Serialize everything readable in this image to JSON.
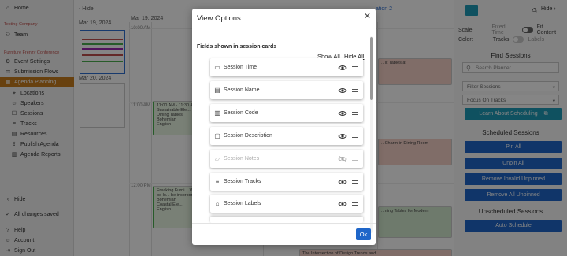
{
  "sidebar": {
    "home": "Home",
    "org": "Testing Company",
    "team": "Team",
    "conference": "Furniture Frenzy Conference",
    "items": [
      {
        "label": "Event Settings",
        "icon": "settings-icon"
      },
      {
        "label": "Submission Flows",
        "icon": "flow-icon"
      },
      {
        "label": "Agenda Planning",
        "icon": "calendar-icon"
      },
      {
        "label": "Locations",
        "icon": "location-icon"
      },
      {
        "label": "Speakers",
        "icon": "person-icon"
      },
      {
        "label": "Sessions",
        "icon": "session-icon"
      },
      {
        "label": "Tracks",
        "icon": "tracks-icon"
      },
      {
        "label": "Resources",
        "icon": "resources-icon"
      },
      {
        "label": "Publish Agenda",
        "icon": "publish-icon"
      },
      {
        "label": "Agenda Reports",
        "icon": "report-icon"
      }
    ],
    "hide": "Hide",
    "saved": "All changes saved",
    "help": "Help",
    "account": "Account",
    "signout": "Sign Out"
  },
  "calendar": {
    "hide": "Hide",
    "date1": "Mar 19, 2024",
    "date2": "Mar 20, 2024",
    "col_date": "Mar 19, 2024",
    "times": [
      "10:00 AM",
      "11:00 AM",
      "12:00 PM"
    ],
    "partial_header": "ation 2",
    "card_a_time": "11:00 AM - 11:30 AM",
    "card_a_title": "Sustainable Ele... Dining Tables",
    "card_a_person": "Bohemian",
    "card_a_lang": "English",
    "card_b_title": "Freaking Furni... We will be lo... be incorporate...",
    "card_b_person1": "Bohemian",
    "card_b_person2": "Coastal Ele...",
    "card_b_lang": "English",
    "card_c_title": "...ic Tables at",
    "card_d_title": "...Charm in Dining Room",
    "card_e_title": "...ning Tables for Modern",
    "card_f_title": "The Intersection of Design Trends and..."
  },
  "right_panel": {
    "hide": "Hide",
    "scale_label": "Scale:",
    "scale_opt1": "Fixed Time",
    "scale_opt2": "Fit Content",
    "color_label": "Color:",
    "color_opt1": "Tracks",
    "color_opt2": "Labels",
    "find_title": "Find Sessions",
    "search_placeholder": "Search Planner",
    "filter_sessions": "Filter Sessions",
    "focus_tracks": "Focus On Tracks",
    "learn_btn": "Learn About Scheduling",
    "scheduled_title": "Scheduled Sessions",
    "pin_all": "Pin All",
    "unpin_all": "Unpin All",
    "remove_invalid": "Remove Invalid Unpinned",
    "remove_all": "Remove All Unpinned",
    "unscheduled_title": "Unscheduled Sessions",
    "auto_schedule": "Auto Schedule"
  },
  "modal": {
    "title": "View Options",
    "subtitle": "Fields shown in session cards",
    "show_all": "Show All",
    "hide_all": "Hide All",
    "fields": [
      {
        "label": "Session Time",
        "icon": "clock-icon",
        "visible": true
      },
      {
        "label": "Session Name",
        "icon": "name-icon",
        "visible": true
      },
      {
        "label": "Session Code",
        "icon": "barcode-icon",
        "visible": true
      },
      {
        "label": "Session Description",
        "icon": "description-icon",
        "visible": true
      },
      {
        "label": "Session Notes",
        "icon": "notes-icon",
        "visible": false
      },
      {
        "label": "Session Tracks",
        "icon": "tracks-icon",
        "visible": true
      },
      {
        "label": "Session Labels",
        "icon": "tag-icon",
        "visible": true
      }
    ],
    "ok": "Ok"
  },
  "colors": {
    "accent": "#c87d1e",
    "primary_button": "#1f66c9",
    "teal_button": "#1d9bb8"
  }
}
